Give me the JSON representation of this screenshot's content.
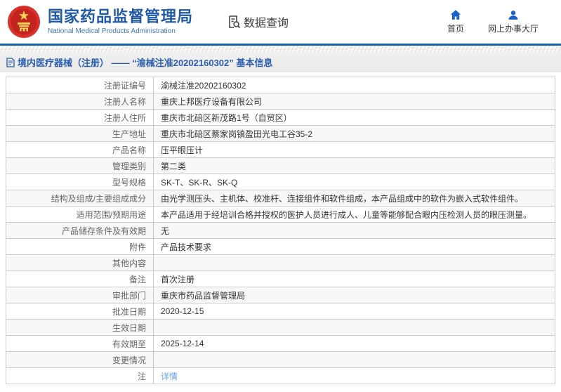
{
  "header": {
    "agency_name_cn": "国家药品监督管理局",
    "agency_name_en": "National Medical Products Administration",
    "nav_data_query": "数据查询",
    "nav_home": "首页",
    "nav_service_hall": "网上办事大厅"
  },
  "breadcrumb": {
    "text": "境内医疗器械（注册） ——  “渝械注准20202160302”  基本信息"
  },
  "table": {
    "rows": [
      {
        "label": "注册证编号",
        "value": "渝械注准20202160302"
      },
      {
        "label": "注册人名称",
        "value": "重庆上邦医疗设备有限公司"
      },
      {
        "label": "注册人住所",
        "value": "重庆市北碚区新茂路1号（自贸区）"
      },
      {
        "label": "生产地址",
        "value": "重庆市北碚区蔡家岗镇盈田光电工谷35-2"
      },
      {
        "label": "产品名称",
        "value": "压平眼压计"
      },
      {
        "label": "管理类别",
        "value": "第二类"
      },
      {
        "label": "型号规格",
        "value": "SK-T、SK-R、SK-Q"
      },
      {
        "label": "结构及组成/主要组成成分",
        "value": "由光学测压头、主机体、校准杆、连接组件和软件组成，本产品组成中的软件为嵌入式软件组件。"
      },
      {
        "label": "适用范围/预期用途",
        "value": "本产品适用于经培训合格并授权的医护人员进行成人、儿童等能够配合眼内压检测人员的眼压测量。"
      },
      {
        "label": "产品储存条件及有效期",
        "value": "无"
      },
      {
        "label": "附件",
        "value": "产品技术要求"
      },
      {
        "label": "其他内容",
        "value": ""
      },
      {
        "label": "备注",
        "value": "首次注册"
      },
      {
        "label": "审批部门",
        "value": "重庆市药品监督管理局"
      },
      {
        "label": "批准日期",
        "value": "2020-12-15"
      },
      {
        "label": "生效日期",
        "value": ""
      },
      {
        "label": "有效期至",
        "value": "2025-12-14"
      },
      {
        "label": "变更情况",
        "value": ""
      },
      {
        "label": "注",
        "value": "详情",
        "link": true,
        "icon": "bulb-icon"
      }
    ]
  },
  "colors": {
    "brand-blue": "#205aa7",
    "icon-blue": "#1b62c9",
    "link-blue": "#64a0e0",
    "emblem-red": "#d8302a",
    "emblem-gold": "#f7d358",
    "bar-gray": "#eaeaea",
    "row-alt": "#f7f7f7",
    "border-gray": "#cccccc"
  }
}
